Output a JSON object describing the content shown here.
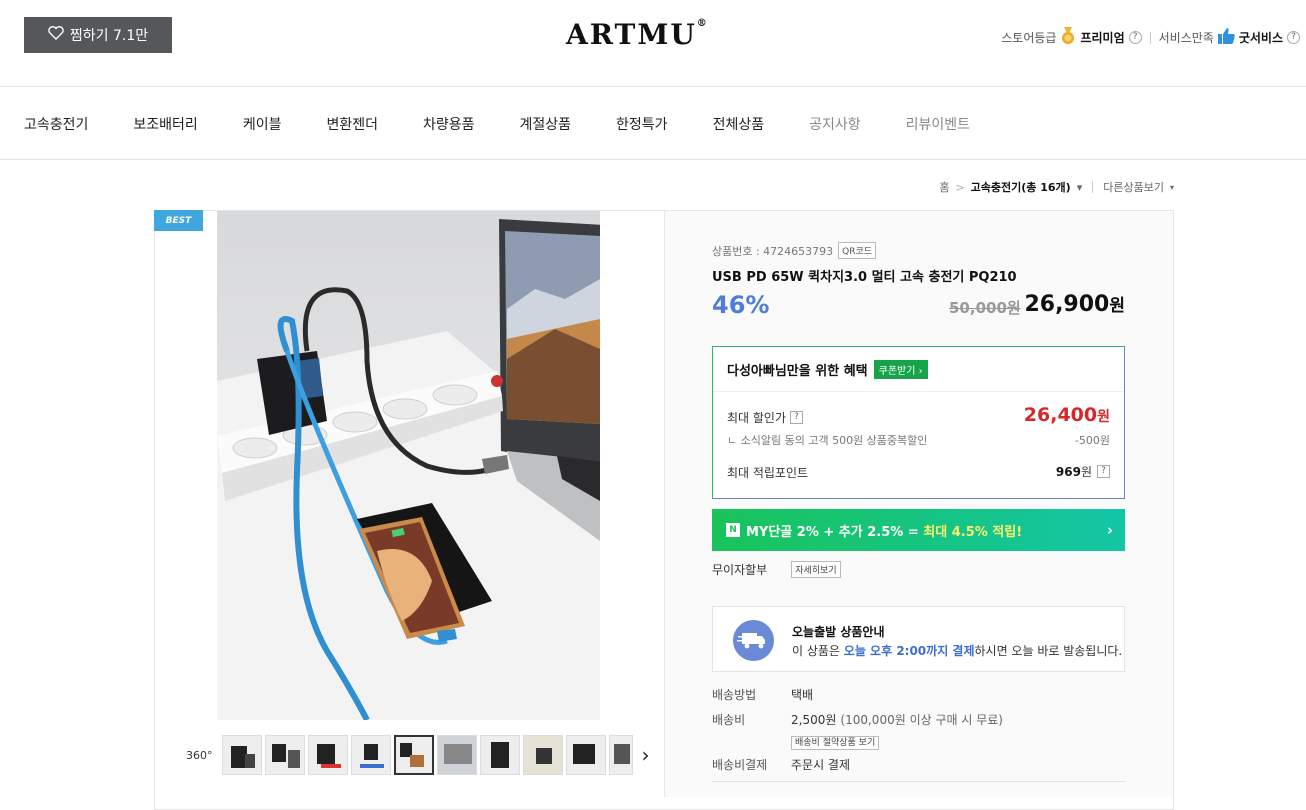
{
  "header": {
    "favorite_label": "찜하기 7.1만",
    "logo": "ARTMU",
    "logo_mark": "®",
    "store_grade_label": "스토어등급",
    "store_grade_value": "프리미엄",
    "service_label": "서비스만족",
    "service_value": "굿서비스",
    "help_mark": "?"
  },
  "nav": {
    "items": [
      "고속충전기",
      "보조배터리",
      "케이블",
      "변환젠더",
      "차량용품",
      "계절상품",
      "한정특가",
      "전체상품",
      "공지사항",
      "리뷰이벤트"
    ]
  },
  "breadcrumb": {
    "home": "홈",
    "separator": ">",
    "category": "고속충전기(총 16개)",
    "other": "다른상품보기"
  },
  "badge": {
    "best": "BEST"
  },
  "product": {
    "id_label": "상품번호 : 4724653793",
    "qr_label": "QR코드",
    "title": "USB PD 65W 퀵차지3.0 멀티 고속 충전기 PQ210",
    "discount": "46%",
    "original_price": "50,000원",
    "sale_price": "26,900",
    "won": "원"
  },
  "benefit": {
    "title": "다성아빠님만을 위한 혜택",
    "coupon_button": "쿠폰받기 ›",
    "max_discount_label": "최대 할인가",
    "max_discount_price": "26,400",
    "max_discount_won": "원",
    "sub_note": "ㄴ 소식알림 동의 고객 500원 상품중복할인",
    "sub_value": "-500원",
    "points_label": "최대 적립포인트",
    "points_value": "969",
    "points_won": "원"
  },
  "my_banner": {
    "icon": "N",
    "text_main": "MY단골 2% + 추가 2.5% = ",
    "text_highlight": "최대 4.5% 적립!",
    "chevron": "›"
  },
  "installment": {
    "label": "무이자할부",
    "button": "자세히보기"
  },
  "today_shipping": {
    "title": "오늘출발 상품안내",
    "text_before": "이 상품은 ",
    "text_highlight": "오늘 오후 2:00까지 결제",
    "text_after": "하시면 오늘 바로 발송됩니다."
  },
  "shipping": {
    "method_label": "배송방법",
    "method_value": "택배",
    "fee_label": "배송비",
    "fee_value": "2,500원",
    "fee_note": "(100,000원 이상 구매 시 무료)",
    "fee_button": "배송비 절약상품 보기",
    "pay_label": "배송비결제",
    "pay_value": "주문시 결제"
  },
  "gallery": {
    "label_360": "360°",
    "next": "›",
    "thumb_count": 10,
    "active_index": 4
  },
  "colors": {
    "discount_blue": "#4f7bd9",
    "price_red": "#d62828",
    "badge_blue": "#3fa6e0",
    "coupon_green": "#16a34a"
  }
}
